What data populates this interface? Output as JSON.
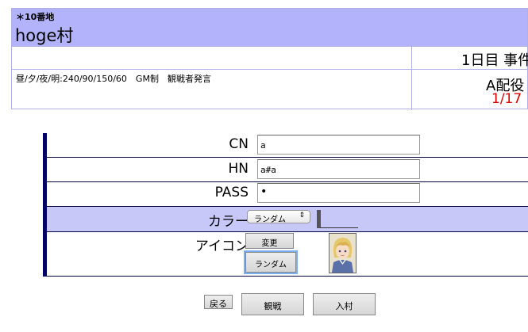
{
  "village": {
    "id": "＊10番地",
    "title": "hoge村",
    "rules": "昼/夕/夜/明:240/90/150/60　GM制　観戦者発言",
    "day_status": "1日目 事件",
    "role_status": "A配役",
    "count": "1/17"
  },
  "form": {
    "cn_label": "CN",
    "cn_value": "a",
    "hn_label": "HN",
    "hn_value": "a#a",
    "pass_label": "PASS",
    "pass_value": "•",
    "color_label": "カラー",
    "color_select": "ランダム",
    "icon_label": "アイコン",
    "icon_change": "変更",
    "icon_random": "ランダム"
  },
  "actions": {
    "back": "戻る",
    "watch": "観戦",
    "join": "入村"
  },
  "colors": {
    "header_bg": "#b3b3fb",
    "color_row_bg": "#c8c8f8",
    "form_bar": "#000066",
    "count_red": "#e00000"
  }
}
